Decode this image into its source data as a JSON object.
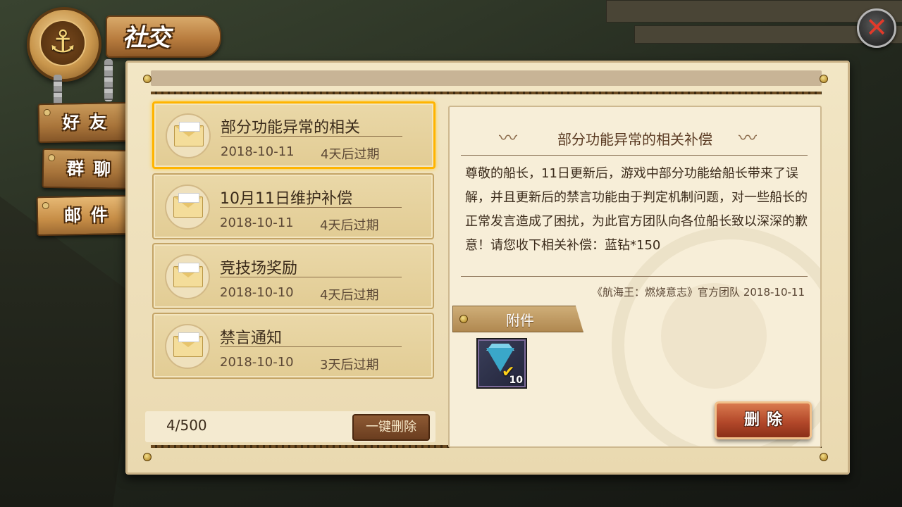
{
  "header": {
    "title": "社交"
  },
  "nav": {
    "tabs": [
      {
        "label": "好友",
        "active": false
      },
      {
        "label": "群聊",
        "active": false
      },
      {
        "label": "邮件",
        "active": true
      }
    ]
  },
  "mail_list": {
    "items": [
      {
        "title": "部分功能异常的相关",
        "date": "2018-10-11",
        "expire": "4天后过期",
        "selected": true
      },
      {
        "title": "10月11日维护补偿",
        "date": "2018-10-11",
        "expire": "4天后过期",
        "selected": false
      },
      {
        "title": "竞技场奖励",
        "date": "2018-10-10",
        "expire": "4天后过期",
        "selected": false
      },
      {
        "title": "禁言通知",
        "date": "2018-10-10",
        "expire": "3天后过期",
        "selected": false
      }
    ],
    "count": "4/500",
    "bulk_delete_label": "一键删除"
  },
  "detail": {
    "title": "部分功能异常的相关补偿",
    "body": "尊敬的船长，11日更新后，游戏中部分功能给船长带来了误解，并且更新后的禁言功能由于判定机制问题，对一些船长的正常发言造成了困扰，为此官方团队向各位船长致以深深的歉意！请您收下相关补偿：蓝钻*150",
    "signature": "《航海王：燃烧意志》官方团队  2018-10-11",
    "attachment_label": "附件",
    "attachment_item": {
      "icon": "blue-diamond-icon",
      "quantity": "10",
      "claimed": true
    },
    "delete_label": "删除"
  },
  "colors": {
    "selected_border": "#ffb400",
    "parchment": "#f2e6c5",
    "delete_button": "#b3482a",
    "close_x": "#e23a2a"
  }
}
